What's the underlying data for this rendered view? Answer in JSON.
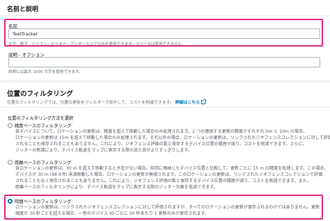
{
  "name_section": {
    "title": "名前と説明",
    "name_label": "名前",
    "name_value": "TestTracker",
    "name_hint": "文字、数字、ハイフン、ピリオド、アンダースコアのみを使用できます。スペースは使用できません。",
    "desc_label": "説明 - オプション",
    "desc_value": "",
    "desc_hint": "説明には最大 1000 文字を使用できます。"
  },
  "filter_section": {
    "title": "位置のフィルタリング",
    "subtitle": "位置のフィルタリングでは、位置の更新をフィルターで除外して、コストを削減できます。",
    "more_link": "詳細はこちら",
    "method_label": "位置のフィルタリング方法を選択",
    "options": [
      {
        "label": "精度ベースのフィルタリング",
        "checked": false,
        "lines": [
          "各デバイスについて、ロケーションの更新は、精度を超えて移動した場合のみ処理されます。2 つの連続する更新の精度がそれぞれ 5m と 10m の場合、",
          "ロケーションの更新は 15m を超えて移動した場合のみ処理されます。それ以外の場合、ロケーションの更新は、リンクされたジオフェンスコレクションに対して評価",
          "されることも保存されることもありません。これにより、ジオフェンス評価の数と保存するデバイス位置の履歴が減り、コストを削減できます。さらに、",
          "ジッターの削減により、デバイス軌道をマップに表示する際の見た目がよりすっきりします。"
        ]
      },
      {
        "label": "距離ベースのフィルタリング",
        "checked": false,
        "lines": [
          "各ロケーションの更新は、30 m を超えて移動すると予定がない場合、前回に格納したデバイス位置と比較して、更新ごとに 15 m の精度を処理します。この場合、",
          "デバイスが 30 m (98.4 ft) 未満移動した場合、ロケーションの更新が無視されます。このロケーションの更新は、リンクされたジオフェンスコレクションで評価",
          "されることもなく保存されることもありません。これにより、ジオフェンス評価の数と保存するデバイス位置の履歴が減り、コストを削減できます。また、",
          "距離ベースのフィルタリングにより、デバイス軌道をマップに表示する際のジッター効果を低減できます。"
        ]
      },
      {
        "label": "時間ベースのフィルタリング",
        "checked": true,
        "lines": [
          "ロケーションの更新は、リンクされたジオフェンスコレクションに対して評価されますが、すべてのロケーションの更新が保存されるわけではありません。更新",
          "頻度が 30 秒ごとを超える場合、一意のデバイス ID ごとに 30 秒あたり 1 更新のみが保存されます。"
        ]
      }
    ]
  },
  "colors": {
    "highlight": "#e0277d",
    "link": "#0073bb"
  }
}
